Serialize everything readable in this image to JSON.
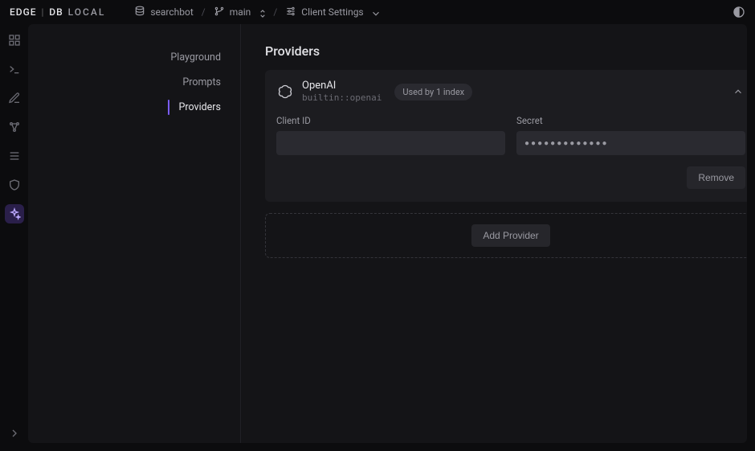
{
  "brand": {
    "edge": "EDGE",
    "db": "DB",
    "local": "LOCAL"
  },
  "breadcrumb": {
    "project": "searchbot",
    "branch": "main",
    "settings": "Client Settings"
  },
  "rail": {
    "items": [
      {
        "name": "dashboard-icon"
      },
      {
        "name": "terminal-icon"
      },
      {
        "name": "edit-icon"
      },
      {
        "name": "graph-icon"
      },
      {
        "name": "list-icon"
      },
      {
        "name": "shield-icon"
      },
      {
        "name": "ai-sparkle-icon"
      }
    ],
    "active_index": 6
  },
  "subnav": {
    "items": [
      {
        "label": "Playground"
      },
      {
        "label": "Prompts"
      },
      {
        "label": "Providers"
      }
    ],
    "active_index": 2
  },
  "pane": {
    "title": "Providers",
    "provider": {
      "name": "OpenAI",
      "subtitle": "builtin::openai",
      "badge": "Used by 1 index",
      "client_id_label": "Client ID",
      "client_id_value": "",
      "secret_label": "Secret",
      "secret_mask": "●●●●●●●●●●●●●",
      "remove_label": "Remove"
    },
    "add_label": "Add Provider"
  }
}
